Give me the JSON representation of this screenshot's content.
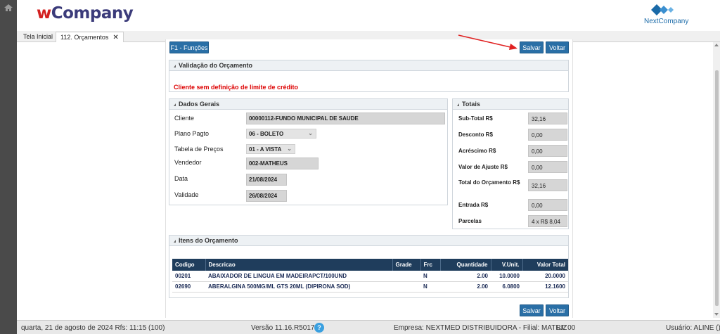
{
  "app": {
    "logo_w": "w",
    "logo_rest": "Company",
    "partner_logo": "NextCompany"
  },
  "tabs": [
    {
      "label": "Tela Inicial"
    },
    {
      "label": "112. Orçamentos",
      "close": "✕"
    }
  ],
  "toolbar": {
    "functions_label": "F1 - Funções",
    "save_label": "Salvar",
    "back_label": "Voltar"
  },
  "validacao": {
    "title": "Validação do Orçamento",
    "message": "Cliente sem definição de limite de crédito"
  },
  "dados_gerais": {
    "title": "Dados Gerais",
    "cliente_label": "Cliente",
    "cliente_value": "00000112-FUNDO MUNICIPAL DE SAUDE",
    "plano_label": "Plano Pagto",
    "plano_value": "06 - BOLETO",
    "tabela_label": "Tabela de Preços",
    "tabela_value": "01 - A VISTA",
    "vendedor_label": "Vendedor",
    "vendedor_value": "002-MATHEUS",
    "data_label": "Data",
    "data_value": "21/08/2024",
    "validade_label": "Validade",
    "validade_value": "26/08/2024"
  },
  "totais": {
    "title": "Totais",
    "rows": [
      {
        "label": "Sub-Total R$",
        "value": "32,16"
      },
      {
        "label": "Desconto R$",
        "value": "0,00"
      },
      {
        "label": "Acréscimo R$",
        "value": "0,00"
      },
      {
        "label": "Valor de Ajuste R$",
        "value": "0,00"
      },
      {
        "label": "Total do Orçamento R$",
        "value": "32,16"
      },
      {
        "label": "Entrada R$",
        "value": "0,00"
      },
      {
        "label": "Parcelas",
        "value": "4 x R$ 8,04"
      }
    ]
  },
  "itens": {
    "title": "Itens do Orçamento",
    "columns": [
      "Codigo",
      "Descricao",
      "Grade",
      "Frc",
      "Quantidade",
      "V.Unit.",
      "Valor Total"
    ],
    "rows": [
      [
        "00201",
        "ABAIXADOR DE LINGUA EM MADEIRAPCT/100UND",
        "",
        "N",
        "2.00",
        "10.0000",
        "20.0000"
      ],
      [
        "02690",
        "ABERALGINA 500MG/ML GTS 20ML (DIPIRONA SOD)",
        "",
        "N",
        "2.00",
        "6.0800",
        "12.1600"
      ]
    ]
  },
  "statusbar": {
    "date": "quarta, 21 de agosto de 2024  Rfs: 11:15 (100)",
    "version": "Versão 11.16.R5017",
    "help": "?",
    "empresa": "Empresa: NEXTMED DISTRIBUIDORA - Filial: MATRIZ",
    "lj": "LJ: 00",
    "usuario": "Usuário: ALINE ()"
  },
  "colors": {
    "accent": "#2a6fa6",
    "header_table": "#1f3d5c",
    "warning": "#dd0000"
  }
}
